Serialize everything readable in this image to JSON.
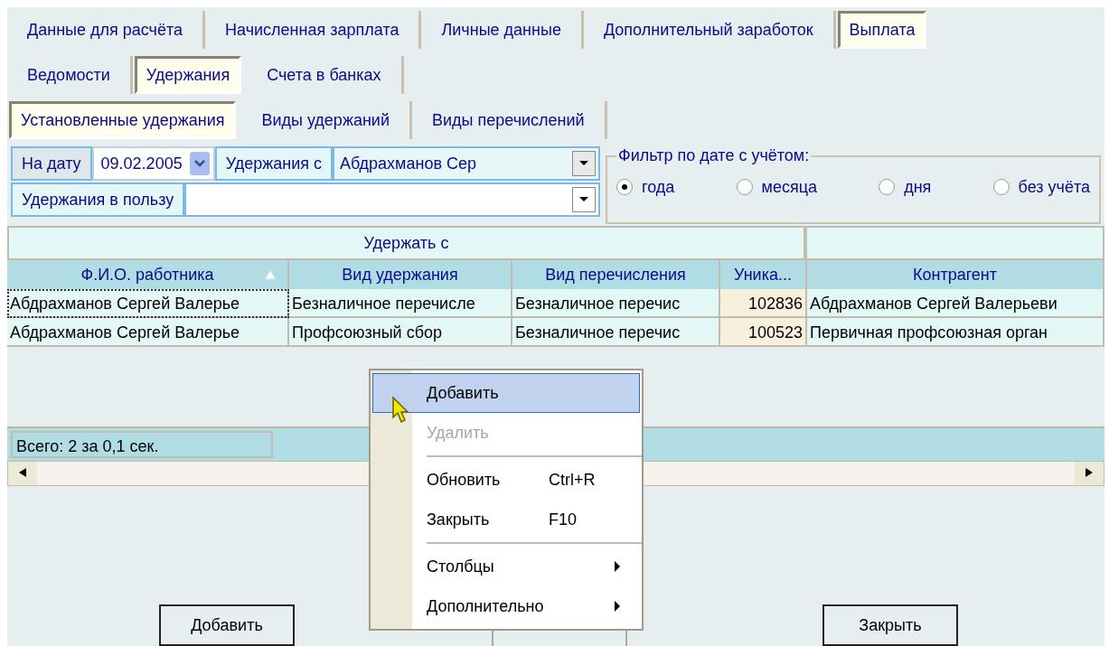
{
  "tab_rows": [
    [
      {
        "label": "Данные для расчёта",
        "selected": false
      },
      {
        "label": "Начисленная зарплата",
        "selected": false
      },
      {
        "label": "Личные данные",
        "selected": false
      },
      {
        "label": "Дополнительный заработок",
        "selected": false
      },
      {
        "label": "Выплата",
        "selected": true
      }
    ],
    [
      {
        "label": "Ведомости",
        "selected": false
      },
      {
        "label": "Удержания",
        "selected": true
      },
      {
        "label": "Счета в банках",
        "selected": false
      }
    ],
    [
      {
        "label": "Установленные удержания",
        "selected": true
      },
      {
        "label": "Виды удержаний",
        "selected": false
      },
      {
        "label": "Виды перечислений",
        "selected": false
      }
    ]
  ],
  "filters": {
    "date_label": "На дату",
    "date_value": "09.02.2005",
    "from_label": "Удержания с",
    "from_value": "Абдрахманов Сер",
    "beneficiary_label": "Удержания в пользу"
  },
  "date_filter": {
    "title": "Фильтр по дате с учётом:",
    "options": [
      {
        "label": "года",
        "selected": true
      },
      {
        "label": "месяца",
        "selected": false
      },
      {
        "label": "дня",
        "selected": false
      },
      {
        "label": "без учёта",
        "selected": false
      }
    ]
  },
  "table": {
    "group_headers": [
      "Удержать с"
    ],
    "columns": [
      {
        "label": "Ф.И.О. работника",
        "sorted": true
      },
      {
        "label": "Вид удержания",
        "sorted": false
      },
      {
        "label": "Вид перечисления",
        "sorted": false
      },
      {
        "label": "Уника...",
        "sorted": false
      },
      {
        "label": "Контрагент",
        "sorted": false
      }
    ],
    "rows": [
      {
        "selected": true,
        "cells": [
          "Абдрахманов Сергей Валерье",
          "Безналичное перечисле",
          "Безналичное перечис",
          "102836",
          "Абдрахманов Сергей Валерьеви"
        ]
      },
      {
        "selected": false,
        "cells": [
          "Абдрахманов Сергей Валерье",
          "Профсоюзный сбор",
          "Безналичное перечис",
          "100523",
          "Первичная профсоюзная орган"
        ]
      }
    ]
  },
  "status_bar": "Всего: 2 за 0,1 сек.",
  "buttons": [
    "Добавить",
    "Закрыть"
  ],
  "context_menu": [
    {
      "kind": "item",
      "label": "Добавить",
      "selected": true,
      "disabled": false,
      "submenu": false
    },
    {
      "kind": "item",
      "label": "Удалить",
      "selected": false,
      "disabled": true,
      "submenu": false
    },
    {
      "kind": "separator"
    },
    {
      "kind": "item",
      "label": "Обновить",
      "shortcut": "Ctrl+R",
      "selected": false,
      "disabled": false,
      "submenu": false
    },
    {
      "kind": "item",
      "label": "Закрыть",
      "shortcut": "F10",
      "selected": false,
      "disabled": false,
      "submenu": false
    },
    {
      "kind": "separator"
    },
    {
      "kind": "item",
      "label": "Столбцы",
      "selected": false,
      "disabled": false,
      "submenu": true
    },
    {
      "kind": "item",
      "label": "Дополнительно",
      "selected": false,
      "disabled": false,
      "submenu": true
    }
  ]
}
